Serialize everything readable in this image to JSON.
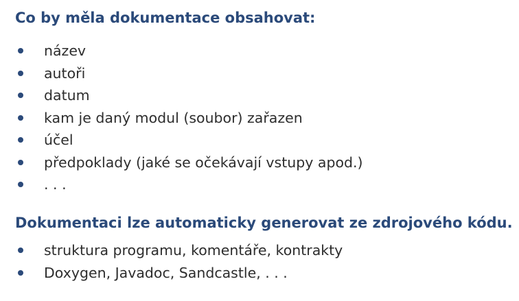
{
  "section1": {
    "heading": "Co by měla dokumentace obsahovat:",
    "items": [
      "název",
      "autoři",
      "datum",
      "kam je daný modul (soubor) zařazen",
      "účel",
      "předpoklady (jaké se očekávají vstupy apod.)",
      ". . ."
    ]
  },
  "section2": {
    "heading": "Dokumentaci lze automaticky generovat ze zdrojového kódu.",
    "items": [
      "struktura programu, komentáře, kontrakty",
      "Doxygen, Javadoc, Sandcastle, . . ."
    ]
  },
  "colors": {
    "heading": "#2b4a7a",
    "bullet": "#2b4a7a",
    "text": "#2d2d2d"
  }
}
